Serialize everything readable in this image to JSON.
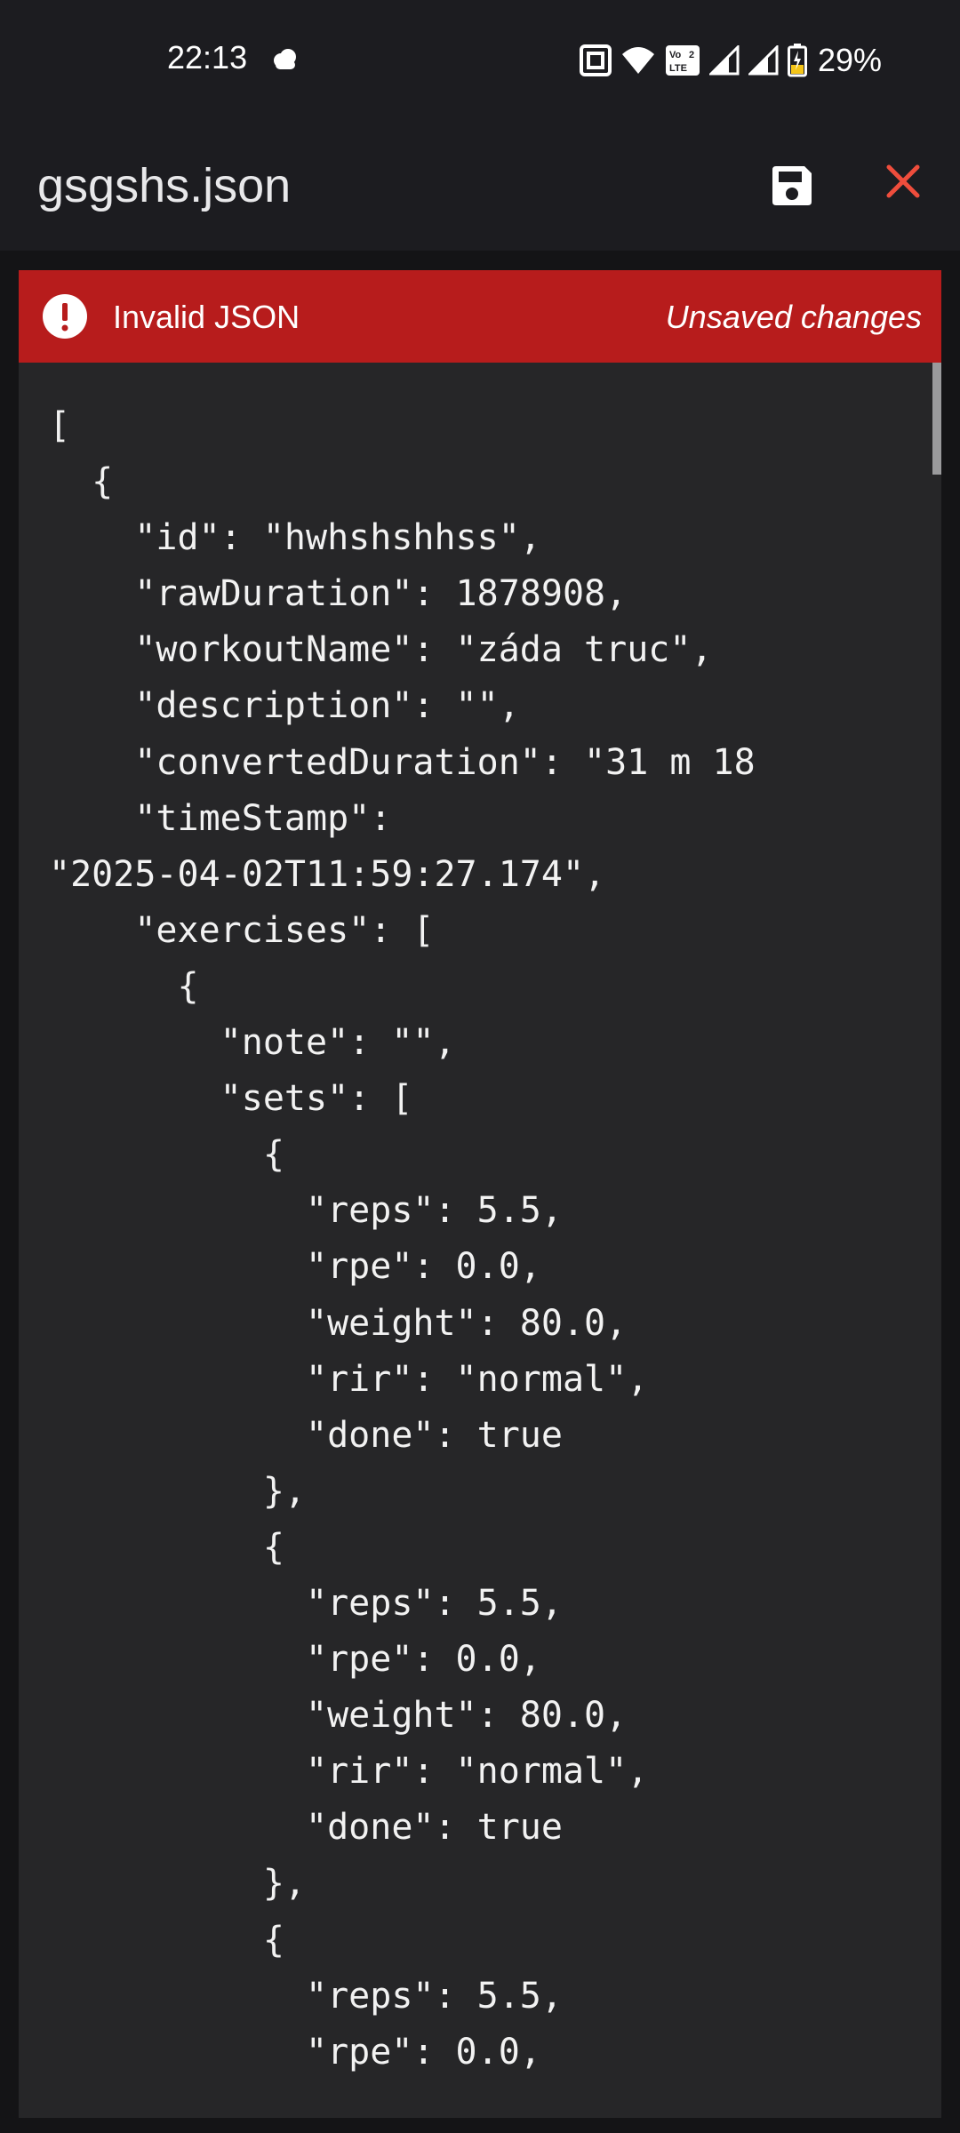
{
  "status_bar": {
    "time": "22:13",
    "battery_percent": "29%",
    "icons": [
      "cloud-icon",
      "nfc-icon",
      "wifi-icon",
      "volte-icon",
      "signal-icon",
      "signal-icon",
      "battery-charging-icon"
    ]
  },
  "app_bar": {
    "title": "gsgshs.json",
    "save_icon": "save-icon",
    "close_icon": "close-icon"
  },
  "banner": {
    "error_text": "Invalid JSON",
    "unsaved_text": "Unsaved changes",
    "color": "#b71c1c"
  },
  "editor": {
    "lines": [
      "[",
      "  {",
      "    \"id\": \"hwhshshhss\",",
      "    \"rawDuration\": 1878908,",
      "    \"workoutName\": \"záda truc\",",
      "    \"description\": \"\",",
      "    \"convertedDuration\": \"31 m 18",
      "    \"timeStamp\":",
      "\"2025-04-02T11:59:27.174\",",
      "    \"exercises\": [",
      "      {",
      "        \"note\": \"\",",
      "        \"sets\": [",
      "          {",
      "            \"reps\": 5.5,",
      "            \"rpe\": 0.0,",
      "            \"weight\": 80.0,",
      "            \"rir\": \"normal\",",
      "            \"done\": true",
      "          },",
      "          {",
      "            \"reps\": 5.5,",
      "            \"rpe\": 0.0,",
      "            \"weight\": 80.0,",
      "            \"rir\": \"normal\",",
      "            \"done\": true",
      "          },",
      "          {",
      "            \"reps\": 5.5,",
      "            \"rpe\": 0.0,"
    ]
  }
}
